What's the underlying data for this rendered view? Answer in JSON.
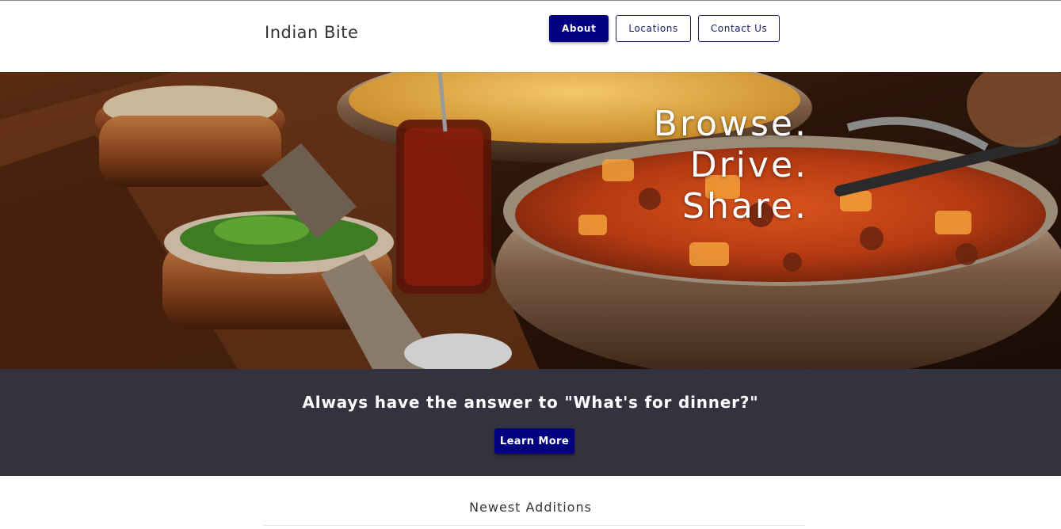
{
  "brand": {
    "name": "Indian Bite"
  },
  "nav": {
    "items": [
      {
        "label": "About",
        "active": true
      },
      {
        "label": "Locations",
        "active": false
      },
      {
        "label": "Contact Us",
        "active": false
      }
    ]
  },
  "hero": {
    "lines": [
      "Browse.",
      "Drive.",
      "Share."
    ]
  },
  "cta": {
    "title": "Always have the answer to \"What's for dinner?\"",
    "button_label": "Learn More"
  },
  "newest": {
    "title": "Newest Additions"
  },
  "colors": {
    "accent": "#000080",
    "cta_background": "#33323f"
  },
  "icons": [
    "food-photo"
  ]
}
